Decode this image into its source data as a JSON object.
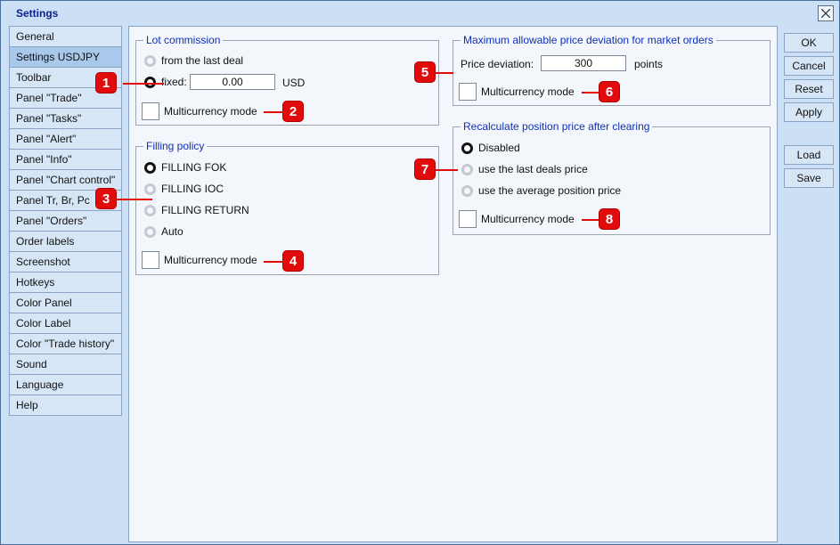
{
  "window": {
    "title": "Settings"
  },
  "nav": {
    "items": [
      {
        "label": "General"
      },
      {
        "label": "Settings USDJPY"
      },
      {
        "label": "Toolbar"
      },
      {
        "label": "Panel \"Trade\""
      },
      {
        "label": "Panel \"Tasks\""
      },
      {
        "label": "Panel \"Alert\""
      },
      {
        "label": "Panel \"Info\""
      },
      {
        "label": "Panel \"Chart control\""
      },
      {
        "label": "Panel Tr, Br, Pc"
      },
      {
        "label": "Panel \"Orders\""
      },
      {
        "label": "Order labels"
      },
      {
        "label": "Screenshot"
      },
      {
        "label": "Hotkeys"
      },
      {
        "label": "Color Panel"
      },
      {
        "label": "Color Label"
      },
      {
        "label": "Color \"Trade history\""
      },
      {
        "label": "Sound"
      },
      {
        "label": "Language"
      },
      {
        "label": "Help"
      }
    ],
    "active": "Settings USDJPY"
  },
  "lot_commission": {
    "title": "Lot commission",
    "option_last_deal": "from the last deal",
    "option_fixed": "fixed:",
    "fixed_value": "0.00",
    "currency": "USD",
    "multicurrency_label": "Multicurrency mode"
  },
  "filling_policy": {
    "title": "Filling policy",
    "options": [
      "FILLING FOK",
      "FILLING IOC",
      "FILLING RETURN",
      "Auto"
    ],
    "selected": "FILLING FOK",
    "multicurrency_label": "Multicurrency mode"
  },
  "price_deviation": {
    "title": "Maximum allowable price deviation for market orders",
    "label": "Price deviation:",
    "value": "300",
    "unit": "points",
    "multicurrency_label": "Multicurrency mode"
  },
  "recalculate": {
    "title": "Recalculate position price after clearing",
    "options": [
      "Disabled",
      "use the last deals price",
      "use the average position price"
    ],
    "selected": "Disabled",
    "multicurrency_label": "Multicurrency mode"
  },
  "callouts": [
    "1",
    "2",
    "3",
    "4",
    "5",
    "6",
    "7",
    "8"
  ],
  "buttons": {
    "ok": "OK",
    "cancel": "Cancel",
    "reset": "Reset",
    "apply": "Apply",
    "load": "Load",
    "save": "Save"
  },
  "colors": {
    "callout": "#e10b0b",
    "group_title": "#1030b8",
    "active_nav": "#a9c9ec"
  }
}
